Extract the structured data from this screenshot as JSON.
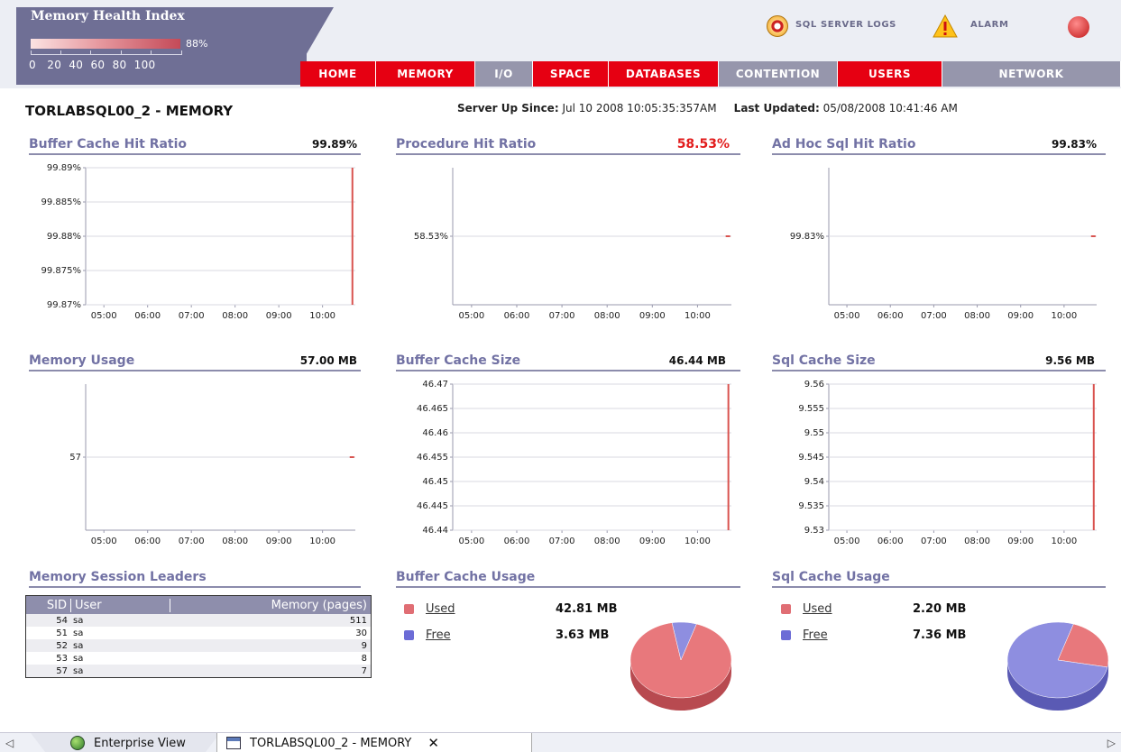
{
  "health_index": {
    "title": "Memory Health Index",
    "percent": "88%",
    "value": 88,
    "scale": "0   20  40  60  80  100"
  },
  "header_links": {
    "sql_logs": "SQL SERVER LOGS",
    "alarm": "ALARM"
  },
  "nav": [
    {
      "label": "HOME",
      "color": "red"
    },
    {
      "label": "MEMORY",
      "color": "red"
    },
    {
      "label": "I/O",
      "color": "gray"
    },
    {
      "label": "SPACE",
      "color": "red"
    },
    {
      "label": "DATABASES",
      "color": "red"
    },
    {
      "label": "CONTENTION",
      "color": "gray"
    },
    {
      "label": "USERS",
      "color": "red"
    },
    {
      "label": "NETWORK",
      "color": "gray"
    }
  ],
  "page": {
    "title": "TORLABSQL00_2 - MEMORY",
    "server_up_label": "Server Up Since:",
    "server_up_value": "Jul 10 2008 10:05:35:357AM",
    "last_updated_label": "Last Updated:",
    "last_updated_value": "05/08/2008 10:41:46 AM"
  },
  "panels": {
    "buffer_cache_hit": {
      "label": "Buffer Cache Hit Ratio",
      "value": "99.89%"
    },
    "procedure_hit": {
      "label": "Procedure Hit Ratio",
      "value": "58.53%"
    },
    "adhoc_hit": {
      "label": "Ad Hoc Sql Hit Ratio",
      "value": "99.83%"
    },
    "memory_usage": {
      "label": "Memory Usage",
      "value": "57.00 MB"
    },
    "buffer_cache_size": {
      "label": "Buffer Cache Size",
      "value": "46.44 MB"
    },
    "sql_cache_size": {
      "label": "Sql Cache Size",
      "value": "9.56 MB"
    },
    "session_leaders": {
      "label": "Memory Session Leaders"
    },
    "buffer_cache_usage": {
      "label": "Buffer Cache Usage"
    },
    "sql_cache_usage": {
      "label": "Sql Cache Usage"
    }
  },
  "colors": {
    "accent_red": "#e60012",
    "nav_gray": "#9696ac",
    "panel_title": "#7272a4",
    "series_red": "#d9534f",
    "pie_used": "#e8787c",
    "pie_free": "#8e8ee0"
  },
  "chart_data": [
    {
      "id": "buffer_cache_hit",
      "type": "line",
      "x_ticks": [
        "05:00",
        "06:00",
        "07:00",
        "08:00",
        "09:00",
        "10:00"
      ],
      "y_ticks": [
        "99.89%",
        "99.885%",
        "99.88%",
        "99.875%",
        "99.87%"
      ],
      "ylim": [
        99.87,
        99.89
      ],
      "series": [
        {
          "points": [
            {
              "x": "10:41",
              "y": 99.87
            },
            {
              "x": "10:41",
              "y": 99.89
            }
          ]
        }
      ]
    },
    {
      "id": "procedure_hit",
      "type": "line",
      "x_ticks": [
        "05:00",
        "06:00",
        "07:00",
        "08:00",
        "09:00",
        "10:00"
      ],
      "y_ticks": [
        "58.53%"
      ],
      "series": [
        {
          "points": [
            {
              "x": "10:41",
              "y": 58.53
            }
          ]
        }
      ]
    },
    {
      "id": "adhoc_hit",
      "type": "line",
      "x_ticks": [
        "05:00",
        "06:00",
        "07:00",
        "08:00",
        "09:00",
        "10:00"
      ],
      "y_ticks": [
        "99.83%"
      ],
      "series": [
        {
          "points": [
            {
              "x": "10:41",
              "y": 99.83
            }
          ]
        }
      ]
    },
    {
      "id": "memory_usage",
      "type": "line",
      "x_ticks": [
        "05:00",
        "06:00",
        "07:00",
        "08:00",
        "09:00",
        "10:00"
      ],
      "y_ticks": [
        "57"
      ],
      "series": [
        {
          "points": [
            {
              "x": "10:41",
              "y": 57
            }
          ]
        }
      ]
    },
    {
      "id": "buffer_cache_size",
      "type": "line",
      "x_ticks": [
        "05:00",
        "06:00",
        "07:00",
        "08:00",
        "09:00",
        "10:00"
      ],
      "y_ticks": [
        "46.47",
        "46.465",
        "46.46",
        "46.455",
        "46.45",
        "46.445",
        "46.44"
      ],
      "ylim": [
        46.44,
        46.47
      ],
      "series": [
        {
          "points": [
            {
              "x": "10:41",
              "y": 46.44
            },
            {
              "x": "10:41",
              "y": 46.47
            }
          ]
        }
      ]
    },
    {
      "id": "sql_cache_size",
      "type": "line",
      "x_ticks": [
        "05:00",
        "06:00",
        "07:00",
        "08:00",
        "09:00",
        "10:00"
      ],
      "y_ticks": [
        "9.56",
        "9.555",
        "9.55",
        "9.545",
        "9.54",
        "9.535",
        "9.53"
      ],
      "ylim": [
        9.53,
        9.56
      ],
      "series": [
        {
          "points": [
            {
              "x": "10:41",
              "y": 9.53
            },
            {
              "x": "10:41",
              "y": 9.56
            }
          ]
        }
      ]
    },
    {
      "id": "buffer_cache_usage",
      "type": "pie",
      "labels": [
        "Used",
        "Free"
      ],
      "values": [
        42.81,
        3.63
      ],
      "value_labels": [
        "42.81 MB",
        "3.63 MB"
      ]
    },
    {
      "id": "sql_cache_usage",
      "type": "pie",
      "labels": [
        "Used",
        "Free"
      ],
      "values": [
        2.2,
        7.36
      ],
      "value_labels": [
        "2.20 MB",
        "7.36 MB"
      ]
    }
  ],
  "session_table": {
    "columns": [
      "SID",
      "User",
      "Memory (pages)"
    ],
    "rows": [
      [
        "54",
        "sa",
        "511"
      ],
      [
        "51",
        "sa",
        "30"
      ],
      [
        "52",
        "sa",
        "9"
      ],
      [
        "53",
        "sa",
        "8"
      ],
      [
        "57",
        "sa",
        "7"
      ]
    ]
  },
  "tabs": {
    "enterprise_view": "Enterprise View",
    "memory_tab": "TORLABSQL00_2 - MEMORY",
    "close": "✕"
  }
}
